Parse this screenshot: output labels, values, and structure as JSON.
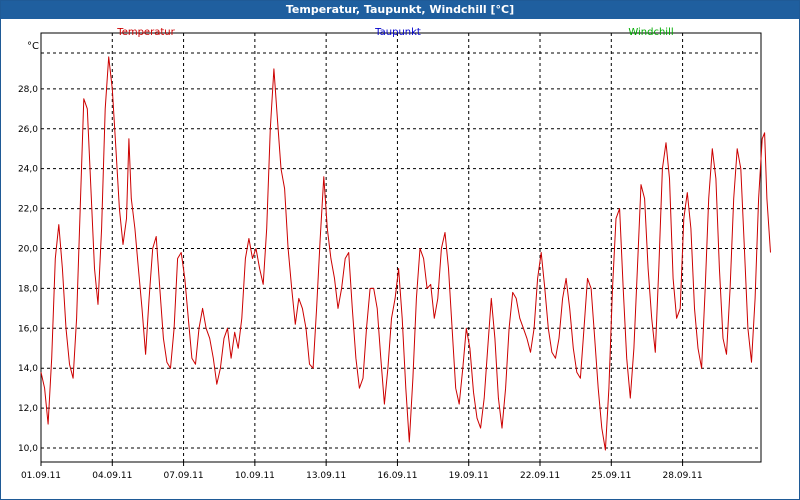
{
  "window": {
    "title": "Temperatur, Taupunkt, Windchill [°C]"
  },
  "chart_data": {
    "type": "line",
    "title": "Temperatur, Taupunkt, Windchill [°C]",
    "ylabel": "°C",
    "ylim": [
      9.3,
      30.8
    ],
    "y_ticks": [
      10,
      12,
      14,
      16,
      18,
      20,
      22,
      24,
      26,
      28
    ],
    "y_tick_labels": [
      "10,0",
      "12,0",
      "14,0",
      "16,0",
      "18,0",
      "20,0",
      "22,0",
      "24,0",
      "26,0",
      "28,0"
    ],
    "xlim": [
      0,
      30.3
    ],
    "x_tick_labels": [
      "01.09.11",
      "04.09.11",
      "07.09.11",
      "10.09.11",
      "13.09.11",
      "16.09.11",
      "19.09.11",
      "22.09.11",
      "25.09.11",
      "28.09.11"
    ],
    "x_tick_positions": [
      0,
      3,
      6,
      9,
      12,
      15,
      18,
      21,
      24,
      27
    ],
    "grid": true,
    "legend": [
      {
        "name": "Temperatur",
        "color": "#cc0000"
      },
      {
        "name": "Taupunkt",
        "color": "#0000cc"
      },
      {
        "name": "Windchill",
        "color": "#00aa00"
      }
    ],
    "series": [
      {
        "name": "Temperatur",
        "color": "#cc0000",
        "points": [
          [
            0,
            13.8
          ],
          [
            0.15,
            13.0
          ],
          [
            0.3,
            11.2
          ],
          [
            0.45,
            14.5
          ],
          [
            0.6,
            19.5
          ],
          [
            0.75,
            21.2
          ],
          [
            0.9,
            19.0
          ],
          [
            1.05,
            16.0
          ],
          [
            1.2,
            14.2
          ],
          [
            1.35,
            13.5
          ],
          [
            1.5,
            16.5
          ],
          [
            1.65,
            22.0
          ],
          [
            1.8,
            27.5
          ],
          [
            1.95,
            27.0
          ],
          [
            2.1,
            23.0
          ],
          [
            2.25,
            19.0
          ],
          [
            2.4,
            17.2
          ],
          [
            2.55,
            21.0
          ],
          [
            2.7,
            27.0
          ],
          [
            2.85,
            29.6
          ],
          [
            3.0,
            28.0
          ],
          [
            3.15,
            25.0
          ],
          [
            3.3,
            22.0
          ],
          [
            3.45,
            20.2
          ],
          [
            3.6,
            21.5
          ],
          [
            3.7,
            25.5
          ],
          [
            3.8,
            22.5
          ],
          [
            3.95,
            21.0
          ],
          [
            4.1,
            19.0
          ],
          [
            4.25,
            17.0
          ],
          [
            4.4,
            14.7
          ],
          [
            4.55,
            17.5
          ],
          [
            4.7,
            20.0
          ],
          [
            4.85,
            20.6
          ],
          [
            5.0,
            18.0
          ],
          [
            5.15,
            15.5
          ],
          [
            5.3,
            14.3
          ],
          [
            5.45,
            14.0
          ],
          [
            5.6,
            16.0
          ],
          [
            5.75,
            19.5
          ],
          [
            5.9,
            19.8
          ],
          [
            6.05,
            18.5
          ],
          [
            6.2,
            16.5
          ],
          [
            6.35,
            14.5
          ],
          [
            6.5,
            14.2
          ],
          [
            6.65,
            16.0
          ],
          [
            6.8,
            17.0
          ],
          [
            6.95,
            16.0
          ],
          [
            7.1,
            15.5
          ],
          [
            7.25,
            14.5
          ],
          [
            7.4,
            13.2
          ],
          [
            7.55,
            14.0
          ],
          [
            7.7,
            15.5
          ],
          [
            7.85,
            16.0
          ],
          [
            8.0,
            14.5
          ],
          [
            8.15,
            15.8
          ],
          [
            8.3,
            15.0
          ],
          [
            8.45,
            16.5
          ],
          [
            8.6,
            19.5
          ],
          [
            8.75,
            20.5
          ],
          [
            8.9,
            19.5
          ],
          [
            9.05,
            20.0
          ],
          [
            9.2,
            19.0
          ],
          [
            9.35,
            18.2
          ],
          [
            9.5,
            21.0
          ],
          [
            9.65,
            26.0
          ],
          [
            9.8,
            29.0
          ],
          [
            9.95,
            26.5
          ],
          [
            10.1,
            24.0
          ],
          [
            10.25,
            23.0
          ],
          [
            10.4,
            20.0
          ],
          [
            10.55,
            18.0
          ],
          [
            10.7,
            16.2
          ],
          [
            10.85,
            17.5
          ],
          [
            11.0,
            17.0
          ],
          [
            11.15,
            16.0
          ],
          [
            11.3,
            14.2
          ],
          [
            11.45,
            14.0
          ],
          [
            11.6,
            17.0
          ],
          [
            11.75,
            20.5
          ],
          [
            11.9,
            23.6
          ],
          [
            12.05,
            21.0
          ],
          [
            12.2,
            19.5
          ],
          [
            12.35,
            18.5
          ],
          [
            12.5,
            17.0
          ],
          [
            12.65,
            18.0
          ],
          [
            12.8,
            19.5
          ],
          [
            12.95,
            19.8
          ],
          [
            13.1,
            17.0
          ],
          [
            13.25,
            14.5
          ],
          [
            13.4,
            13.0
          ],
          [
            13.55,
            13.5
          ],
          [
            13.7,
            16.0
          ],
          [
            13.85,
            18.0
          ],
          [
            14.0,
            18.0
          ],
          [
            14.15,
            17.0
          ],
          [
            14.3,
            14.5
          ],
          [
            14.45,
            12.2
          ],
          [
            14.6,
            14.0
          ],
          [
            14.75,
            16.5
          ],
          [
            14.9,
            17.5
          ],
          [
            15.05,
            19.0
          ],
          [
            15.2,
            16.5
          ],
          [
            15.35,
            13.0
          ],
          [
            15.5,
            10.3
          ],
          [
            15.65,
            13.5
          ],
          [
            15.8,
            17.5
          ],
          [
            15.95,
            20.0
          ],
          [
            16.1,
            19.5
          ],
          [
            16.25,
            18.0
          ],
          [
            16.4,
            18.2
          ],
          [
            16.55,
            16.5
          ],
          [
            16.7,
            17.5
          ],
          [
            16.85,
            20.0
          ],
          [
            17.0,
            20.8
          ],
          [
            17.15,
            19.0
          ],
          [
            17.3,
            16.0
          ],
          [
            17.45,
            13.0
          ],
          [
            17.6,
            12.2
          ],
          [
            17.75,
            14.0
          ],
          [
            17.9,
            16.0
          ],
          [
            18.05,
            15.0
          ],
          [
            18.2,
            12.8
          ],
          [
            18.35,
            11.5
          ],
          [
            18.5,
            11.0
          ],
          [
            18.65,
            12.5
          ],
          [
            18.8,
            15.0
          ],
          [
            18.95,
            17.5
          ],
          [
            19.1,
            15.5
          ],
          [
            19.25,
            12.5
          ],
          [
            19.4,
            11.0
          ],
          [
            19.55,
            13.0
          ],
          [
            19.7,
            16.0
          ],
          [
            19.85,
            17.8
          ],
          [
            20.0,
            17.5
          ],
          [
            20.15,
            16.5
          ],
          [
            20.3,
            16.0
          ],
          [
            20.45,
            15.5
          ],
          [
            20.6,
            14.8
          ],
          [
            20.75,
            16.0
          ],
          [
            20.9,
            18.5
          ],
          [
            21.05,
            19.8
          ],
          [
            21.2,
            18.0
          ],
          [
            21.35,
            16.0
          ],
          [
            21.5,
            14.8
          ],
          [
            21.65,
            14.5
          ],
          [
            21.8,
            15.5
          ],
          [
            21.95,
            17.5
          ],
          [
            22.1,
            18.5
          ],
          [
            22.25,
            17.0
          ],
          [
            22.4,
            15.0
          ],
          [
            22.55,
            13.8
          ],
          [
            22.7,
            13.5
          ],
          [
            22.85,
            16.0
          ],
          [
            23.0,
            18.5
          ],
          [
            23.15,
            18.0
          ],
          [
            23.3,
            15.5
          ],
          [
            23.45,
            13.0
          ],
          [
            23.6,
            11.0
          ],
          [
            23.75,
            9.9
          ],
          [
            23.9,
            13.0
          ],
          [
            24.05,
            18.0
          ],
          [
            24.2,
            21.5
          ],
          [
            24.35,
            22.0
          ],
          [
            24.5,
            18.0
          ],
          [
            24.65,
            14.5
          ],
          [
            24.8,
            12.5
          ],
          [
            24.95,
            15.0
          ],
          [
            25.1,
            19.0
          ],
          [
            25.25,
            23.2
          ],
          [
            25.4,
            22.5
          ],
          [
            25.55,
            19.0
          ],
          [
            25.7,
            16.5
          ],
          [
            25.85,
            14.8
          ],
          [
            26.0,
            19.0
          ],
          [
            26.15,
            24.0
          ],
          [
            26.3,
            25.3
          ],
          [
            26.45,
            23.5
          ],
          [
            26.6,
            18.5
          ],
          [
            26.75,
            16.5
          ],
          [
            26.9,
            17.0
          ],
          [
            27.05,
            21.5
          ],
          [
            27.2,
            22.8
          ],
          [
            27.35,
            21.0
          ],
          [
            27.5,
            17.0
          ],
          [
            27.65,
            15.0
          ],
          [
            27.8,
            14.0
          ],
          [
            27.95,
            18.0
          ],
          [
            28.1,
            22.5
          ],
          [
            28.25,
            25.0
          ],
          [
            28.4,
            23.5
          ],
          [
            28.55,
            19.0
          ],
          [
            28.7,
            15.5
          ],
          [
            28.85,
            14.7
          ],
          [
            29.0,
            18.0
          ],
          [
            29.15,
            22.5
          ],
          [
            29.3,
            25.0
          ],
          [
            29.45,
            24.0
          ],
          [
            29.6,
            20.0
          ],
          [
            29.75,
            16.0
          ],
          [
            29.9,
            14.3
          ],
          [
            30.05,
            17.5
          ],
          [
            30.2,
            22.5
          ],
          [
            30.35,
            25.5
          ],
          [
            30.45,
            25.8
          ],
          [
            30.55,
            22.5
          ],
          [
            30.7,
            19.8
          ]
        ]
      }
    ]
  }
}
